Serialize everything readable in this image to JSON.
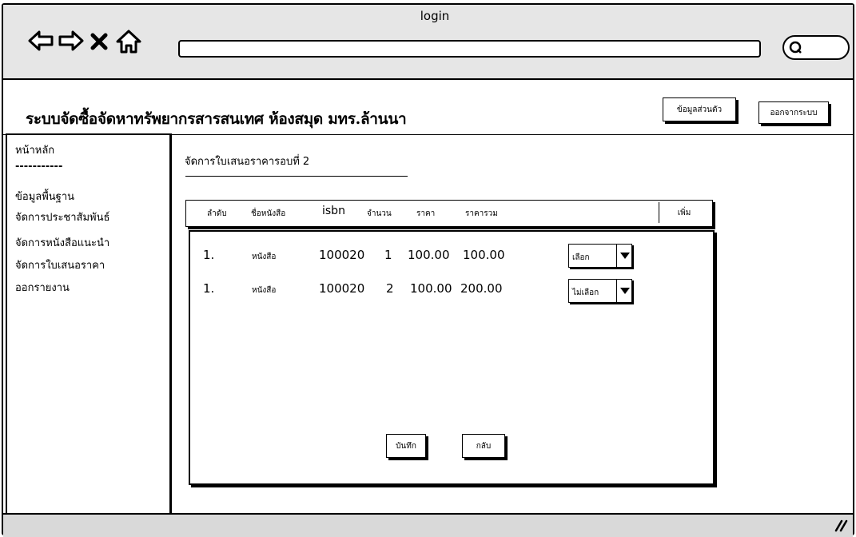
{
  "window": {
    "title": "login"
  },
  "icons": {
    "back": "back-arrow-icon",
    "forward": "forward-arrow-icon",
    "close": "close-icon",
    "home": "home-icon",
    "search": "search-icon",
    "resize": "resize-grip-icon"
  },
  "header": {
    "title": "ระบบจัดซื้อจัดหาทรัพยากรสารสนเทศ ห้องสมุด มทร.ล้านนา",
    "profile_button": "ข้อมูลส่วนตัว",
    "logout_button": "ออกจากระบบ"
  },
  "sidebar": {
    "items": [
      {
        "label": "หน้าหลัก"
      },
      {
        "label": "-----------"
      },
      {
        "label": "ข้อมูลพื้นฐาน"
      },
      {
        "label": "จัดการประชาสัมพันธ์"
      },
      {
        "label": "จัดการหนังสือแนะนำ"
      },
      {
        "label": "จัดการใบเสนอราคา"
      },
      {
        "label": "ออกรายงาน"
      }
    ]
  },
  "main": {
    "section_title": "จัดการใบเสนอราคารอบที่ 2",
    "table": {
      "columns": [
        "ลำดับ",
        "ชื่อหนังสือ",
        "isbn",
        "จำนวน",
        "ราคา",
        "ราคารวม"
      ],
      "add_button": "เพิ่ม",
      "rows": [
        {
          "no": "1.",
          "name": "หนังสือ",
          "isbn": "100020",
          "qty": "1",
          "price": "100.00",
          "total": "100.00",
          "select": "เลือก"
        },
        {
          "no": "1.",
          "name": "หนังสือ",
          "isbn": "100020",
          "qty": "2",
          "price": "100.00",
          "total": "200.00",
          "select": "ไม่เลือก"
        }
      ]
    },
    "save_button": "บันทึก",
    "back_button": "กลับ"
  }
}
